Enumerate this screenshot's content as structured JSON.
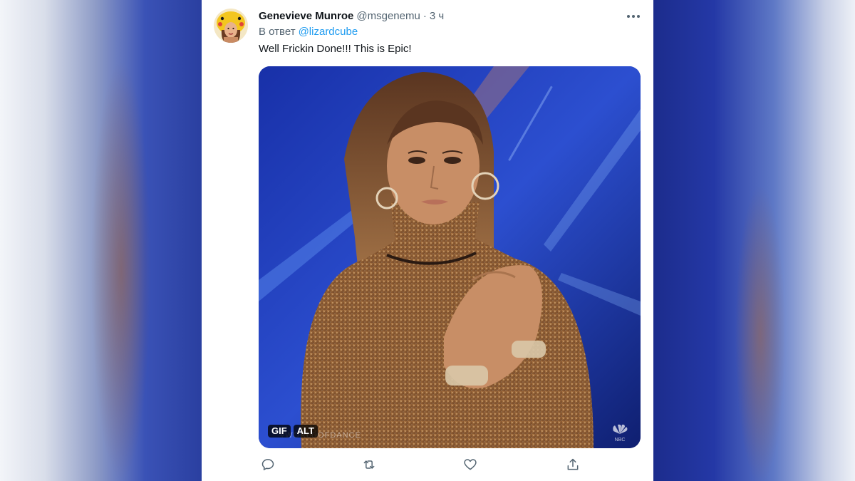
{
  "tweet": {
    "author_name": "Genevieve Munroe",
    "author_handle": "@msgenemu",
    "separator": "·",
    "time": "3 ч",
    "reply_prefix": "В ответ",
    "reply_to": "@lizardcube",
    "text": "Well Frickin Done!!! This is Epic!"
  },
  "media": {
    "type_badge": "GIF",
    "alt_badge": "ALT",
    "watermark": "#WORLDOFDANCE",
    "network_logo": "NBC"
  },
  "icons": {
    "more": "more-horizontal-icon",
    "reply": "reply-icon",
    "retweet": "retweet-icon",
    "like": "like-icon",
    "share": "share-icon"
  },
  "colors": {
    "accent": "#1d9bf0",
    "text_primary": "#0f1419",
    "text_secondary": "#536471"
  }
}
